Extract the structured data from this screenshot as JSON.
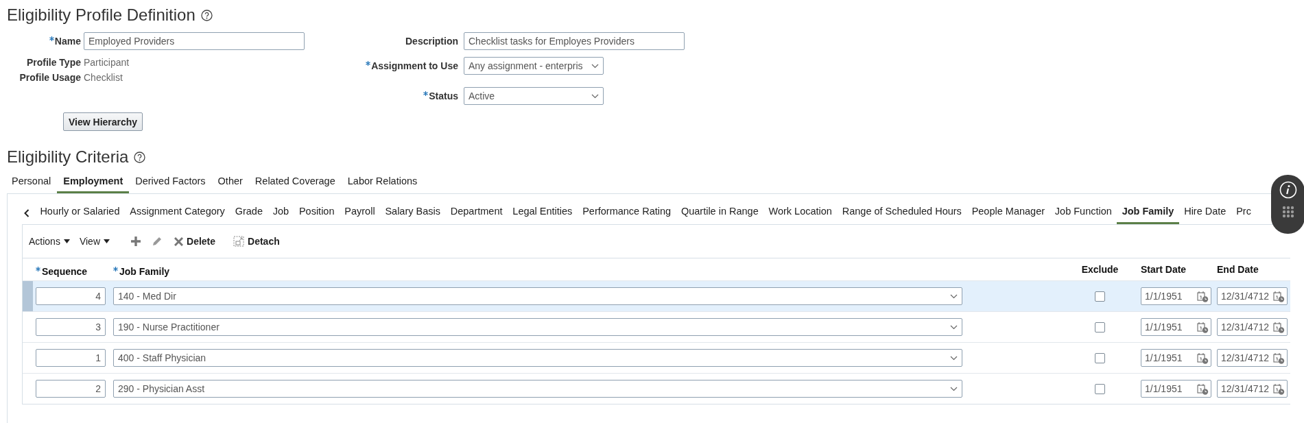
{
  "page": {
    "title": "Eligibility Profile Definition"
  },
  "form": {
    "name": {
      "label": "Name",
      "required": true,
      "value": "Employed Providers"
    },
    "profile_type": {
      "label": "Profile Type",
      "value": "Participant"
    },
    "profile_usage": {
      "label": "Profile Usage",
      "value": "Checklist"
    },
    "description": {
      "label": "Description",
      "value": "Checklist tasks for Employes Providers"
    },
    "assignment_to_use": {
      "label": "Assignment to Use",
      "required": true,
      "value": "Any assignment - enterpris"
    },
    "status": {
      "label": "Status",
      "required": true,
      "value": "Active"
    },
    "view_hierarchy_button": "View Hierarchy"
  },
  "criteria": {
    "title": "Eligibility Criteria",
    "tabs": [
      {
        "label": "Personal",
        "selected": false
      },
      {
        "label": "Employment",
        "selected": true
      },
      {
        "label": "Derived Factors",
        "selected": false
      },
      {
        "label": "Other",
        "selected": false
      },
      {
        "label": "Related Coverage",
        "selected": false
      },
      {
        "label": "Labor Relations",
        "selected": false
      }
    ],
    "sub_tabs": [
      {
        "label": "Hourly or Salaried",
        "selected": false
      },
      {
        "label": "Assignment Category",
        "selected": false
      },
      {
        "label": "Grade",
        "selected": false
      },
      {
        "label": "Job",
        "selected": false
      },
      {
        "label": "Position",
        "selected": false
      },
      {
        "label": "Payroll",
        "selected": false
      },
      {
        "label": "Salary Basis",
        "selected": false
      },
      {
        "label": "Department",
        "selected": false
      },
      {
        "label": "Legal Entities",
        "selected": false
      },
      {
        "label": "Performance Rating",
        "selected": false
      },
      {
        "label": "Quartile in Range",
        "selected": false
      },
      {
        "label": "Work Location",
        "selected": false
      },
      {
        "label": "Range of Scheduled Hours",
        "selected": false
      },
      {
        "label": "People Manager",
        "selected": false
      },
      {
        "label": "Job Function",
        "selected": false
      },
      {
        "label": "Job Family",
        "selected": true
      },
      {
        "label": "Hire Date",
        "selected": false
      },
      {
        "label": "Prc",
        "selected": false
      }
    ],
    "toolbar": {
      "actions": "Actions",
      "view": "View",
      "delete": "Delete",
      "detach": "Detach"
    },
    "table": {
      "columns": [
        {
          "label": "Sequence",
          "required": true
        },
        {
          "label": "Job Family",
          "required": true
        },
        {
          "label": "Exclude",
          "required": false
        },
        {
          "label": "Start Date",
          "required": false
        },
        {
          "label": "End Date",
          "required": false
        }
      ],
      "rows": [
        {
          "selected": true,
          "sequence": "4",
          "job_family": "140 - Med Dir",
          "exclude": false,
          "start_date": "1/1/1951",
          "end_date": "12/31/4712"
        },
        {
          "selected": false,
          "sequence": "3",
          "job_family": "190 - Nurse Practitioner",
          "exclude": false,
          "start_date": "1/1/1951",
          "end_date": "12/31/4712"
        },
        {
          "selected": false,
          "sequence": "1",
          "job_family": "400 - Staff Physician",
          "exclude": false,
          "start_date": "1/1/1951",
          "end_date": "12/31/4712"
        },
        {
          "selected": false,
          "sequence": "2",
          "job_family": "290 - Physician Asst",
          "exclude": false,
          "start_date": "1/1/1951",
          "end_date": "12/31/4712"
        }
      ]
    }
  }
}
